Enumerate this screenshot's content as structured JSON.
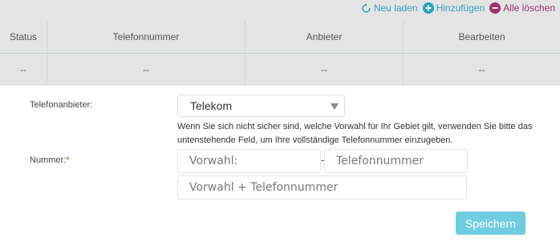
{
  "toolbar": {
    "reload_label": "Neu laden",
    "add_label": "Hinzufügen",
    "delete_all_label": "Alle löschen"
  },
  "table": {
    "columns": [
      "Status",
      "Telefonnummer",
      "Anbieter",
      "Bearbeiten"
    ],
    "rows": [
      [
        "--",
        "--",
        "--",
        "--"
      ]
    ]
  },
  "form": {
    "provider_label": "Telefonanbieter:",
    "provider_value": "Telekom",
    "hint": "Wenn Sie sich nicht sicher sind, welche Vorwahl für Ihr Gebiet gilt, verwenden Sie bitte das untenstehende Feld, um Ihre vollständige Telefonnummer einzugeben.",
    "number_label": "Nummer:",
    "required_mark": "*",
    "area_code_placeholder": "Vorwahl:",
    "separator": "-",
    "phone_placeholder": "Telefonnummer",
    "full_number_placeholder": "Vorwahl + Telefonnummer",
    "save_label": "Speichern"
  },
  "colors": {
    "toolbar_teal": "#2aa3c2",
    "toolbar_purple": "#a0306a",
    "table_bg": "#e4e4e4",
    "save_button": "#6fcde0"
  }
}
